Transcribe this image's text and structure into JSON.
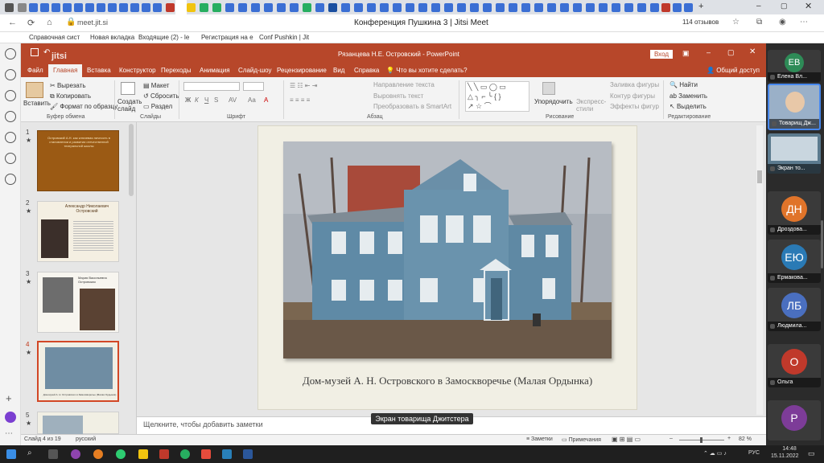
{
  "browser": {
    "url": "meet.jit.si",
    "tab_title": "Конференция Пушкина 3 | Jitsi Meet",
    "reviews": "114 отзывов",
    "bookmarks": [
      "Справочная сист",
      "Новая вкладка",
      "Входящие (2) - le",
      "Регистрация на е",
      "Conf Pushkin | Jit"
    ]
  },
  "ppt": {
    "title": "Рязанцева Н.Е. Островский - PowerPoint",
    "login": "Вход",
    "brand": "jitsi",
    "tabs": [
      "Файл",
      "Главная",
      "Вставка",
      "Конструктор",
      "Переходы",
      "Анимация",
      "Слайд-шоу",
      "Рецензирование",
      "Вид",
      "Справка",
      "Что вы хотите сделать?",
      "Общий доступ"
    ],
    "ribbon": {
      "paste": "Вставить",
      "cut": "Вырезать",
      "copy": "Копировать",
      "format_painter": "Формат по образцу",
      "new_slide": "Создать слайд",
      "layout": "Макет",
      "reset": "Сбросить",
      "section": "Раздел",
      "text_direction": "Направление текста",
      "align_text": "Выровнять текст",
      "smartart": "Преобразовать в SmartArt",
      "arrange": "Упорядочить",
      "quick_styles": "Экспресс-стили",
      "shape_fill": "Заливка фигуры",
      "shape_outline": "Контур фигуры",
      "shape_effects": "Эффекты фигур",
      "find": "Найти",
      "replace": "Заменить",
      "select": "Выделить",
      "groups": [
        "Буфер обмена",
        "Слайды",
        "Шрифт",
        "Абзац",
        "Рисование",
        "Редактирование"
      ]
    },
    "thumbnails": [
      {
        "num": "1",
        "title": "Островский А.Н. как ключевая личность в становлении и развитии отечественной театральной школы"
      },
      {
        "num": "2",
        "title": "Александр Николаевич Островский"
      },
      {
        "num": "3",
        "title": "Мария Васильевна Островская"
      },
      {
        "num": "4",
        "title": "Дом-музей А. Н. Островского в Замоскворечье (Малая Ордынка)"
      },
      {
        "num": "5",
        "title": ""
      }
    ],
    "slide_caption": "Дом-музей А. Н. Островского в Замоскворечье (Малая Ордынка)",
    "notes_placeholder": "Щелкните, чтобы добавить заметки",
    "status": {
      "slide": "Слайд 4 из 19",
      "language": "русский",
      "notes": "Заметки",
      "comments": "Примечания",
      "zoom": "82 %"
    }
  },
  "jitsi": {
    "share_label": "Экран товарища Джитстера",
    "participants": [
      {
        "initials": "ЕВ",
        "name": "Елена Вл...",
        "color": "#2e8b57"
      },
      {
        "initials": "",
        "name": "Товарищ Дж...",
        "color": "#9ab0c8"
      },
      {
        "initials": "",
        "name": "Экран то...",
        "color": "#5b7a8e"
      },
      {
        "initials": "ДН",
        "name": "Дроздова...",
        "color": "#e0742a"
      },
      {
        "initials": "ЕЮ",
        "name": "Ермакова...",
        "color": "#2a7ab5"
      },
      {
        "initials": "ЛБ",
        "name": "Людмила...",
        "color": "#4a6fbf"
      },
      {
        "initials": "О",
        "name": "Ольга",
        "color": "#c0392b"
      },
      {
        "initials": "Р",
        "name": "",
        "color": "#7d3c98"
      }
    ]
  },
  "taskbar": {
    "time": "14:48",
    "date": "15.11.2022",
    "lang": "РУС"
  }
}
